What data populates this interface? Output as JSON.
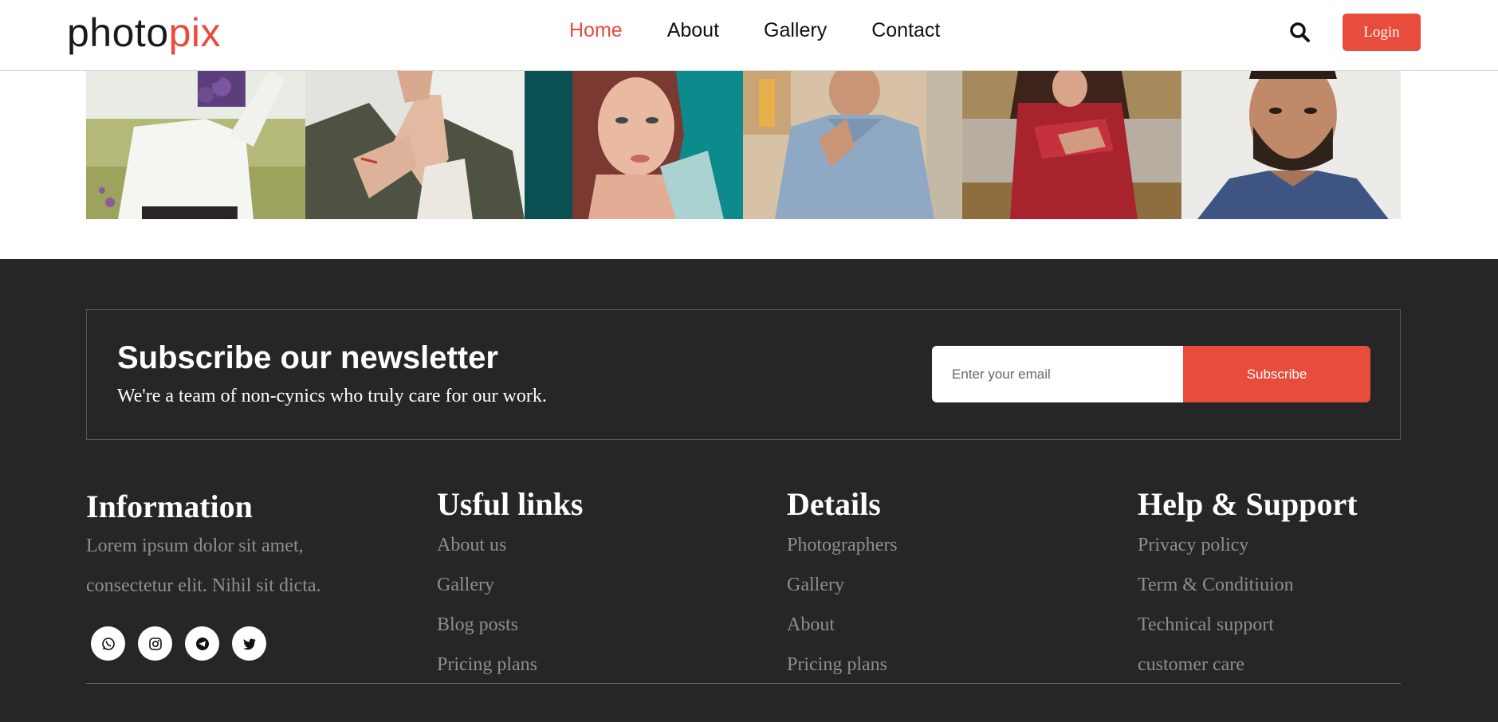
{
  "header": {
    "logo_main": "photo",
    "logo_accent": "pix",
    "nav": [
      {
        "label": "Home",
        "active": true
      },
      {
        "label": "About",
        "active": false
      },
      {
        "label": "Gallery",
        "active": false
      },
      {
        "label": "Contact",
        "active": false
      }
    ],
    "search_icon": "search-icon",
    "login_label": "Login"
  },
  "gallery": {
    "photos": [
      "woman-with-flowers",
      "person-in-jacket",
      "woman-portrait-teal",
      "man-in-polo",
      "woman-in-red-dress",
      "bearded-man-portrait"
    ]
  },
  "newsletter": {
    "title": "Subscribe our newsletter",
    "subtitle": "We're a team of non-cynics who truly care for our work.",
    "email_placeholder": "Enter your email",
    "button_label": "Subscribe"
  },
  "footer": {
    "information": {
      "title": "Information",
      "text_line1": "Lorem ipsum dolor sit amet,",
      "text_line2": "consectetur elit. Nihil sit dicta."
    },
    "useful_links": {
      "title": "Usful links",
      "items": [
        "About us",
        "Gallery",
        "Blog posts",
        "Pricing plans"
      ]
    },
    "details": {
      "title": "Details",
      "items": [
        "Photographers",
        "Gallery",
        "About",
        "Pricing plans"
      ]
    },
    "help": {
      "title": "Help & Support",
      "items": [
        "Privacy policy",
        "Term & Conditiuion",
        "Technical support",
        "customer care"
      ]
    },
    "socials": [
      "whatsapp-icon",
      "instagram-icon",
      "telegram-icon",
      "twitter-icon"
    ]
  },
  "colors": {
    "accent": "#e84c3d",
    "footer_bg": "#262626",
    "link_gray": "#8e8e8e"
  }
}
